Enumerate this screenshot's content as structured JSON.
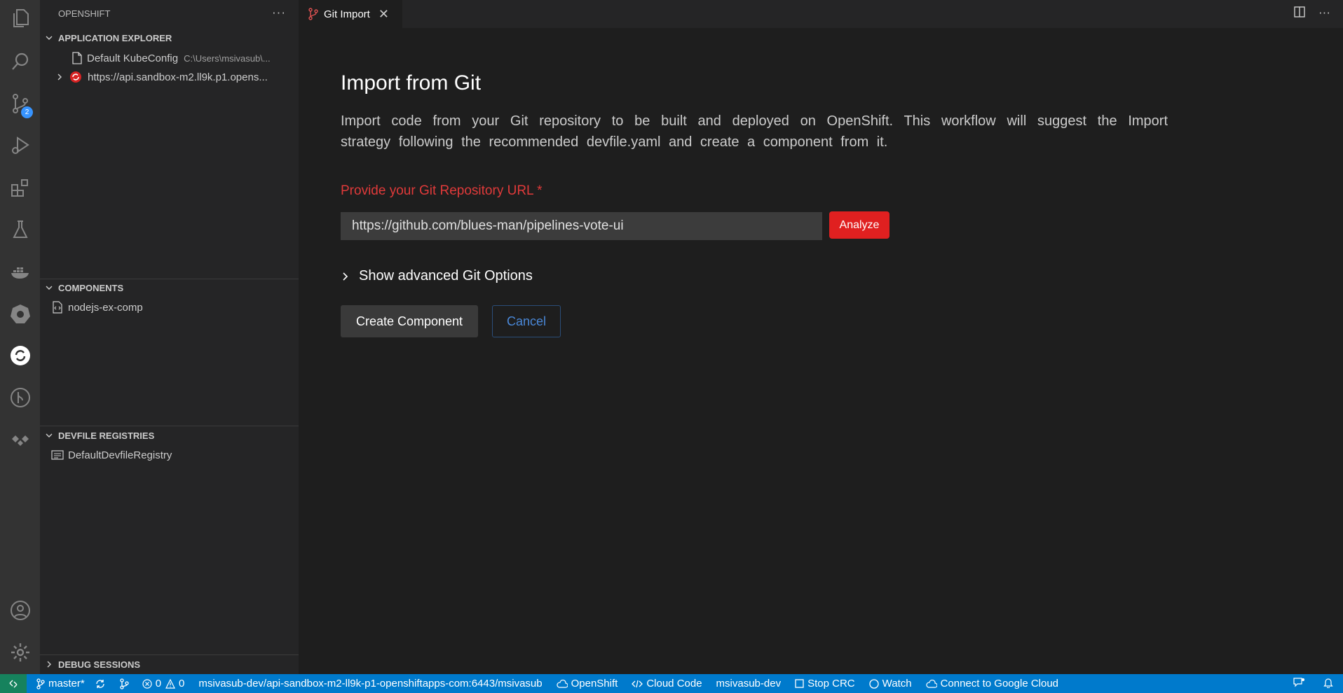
{
  "sidebar": {
    "title": "OPENSHIFT",
    "sections": {
      "app_explorer": {
        "title": "APPLICATION EXPLORER",
        "items": [
          {
            "label": "Default KubeConfig",
            "description": "C:\\Users\\msivasub\\..."
          },
          {
            "label": "https://api.sandbox-m2.ll9k.p1.opens..."
          }
        ]
      },
      "components": {
        "title": "COMPONENTS",
        "items": [
          {
            "label": "nodejs-ex-comp"
          }
        ]
      },
      "devfile_registries": {
        "title": "DEVFILE REGISTRIES",
        "items": [
          {
            "label": "DefaultDevfileRegistry"
          }
        ]
      },
      "debug_sessions": {
        "title": "DEBUG SESSIONS"
      }
    }
  },
  "activity_bar": {
    "scm_badge": "2"
  },
  "editor": {
    "tab_label": "Git Import",
    "title": "Import from Git",
    "description": "Import code from your Git repository to be built and deployed on OpenShift. This workflow will suggest the Import strategy following the recommended devfile.yaml and create a component from it.",
    "url_label": "Provide your Git Repository URL *",
    "url_value": "https://github.com/blues-man/pipelines-vote-ui",
    "analyze_label": "Analyze",
    "advanced_label": "Show advanced Git Options",
    "create_label": "Create Component",
    "cancel_label": "Cancel"
  },
  "status_bar": {
    "branch": "master*",
    "errors": "0",
    "warnings": "0",
    "context": "msivasub-dev/api-sandbox-m2-ll9k-p1-openshiftapps-com:6443/msivasub",
    "openshift": "OpenShift",
    "cloud_code": "Cloud Code",
    "namespace": "msivasub-dev",
    "stop_crc": "Stop CRC",
    "watch": "Watch",
    "google_cloud": "Connect to Google Cloud"
  },
  "colors": {
    "accent": "#007acc",
    "error_red": "#e02020",
    "remote_green": "#16825d"
  }
}
